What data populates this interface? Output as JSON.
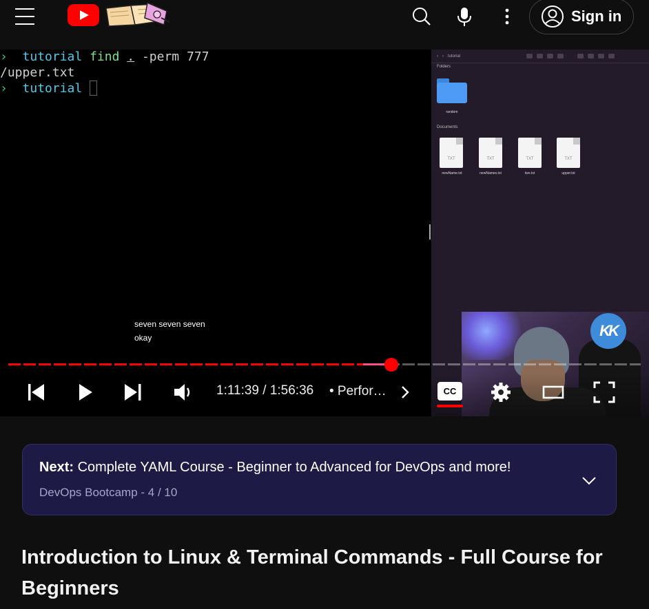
{
  "header": {
    "signin_label": "Sign in",
    "icons": [
      "menu-icon",
      "youtube-logo",
      "search-icon",
      "microphone-icon",
      "more-vertical-icon",
      "account-icon"
    ]
  },
  "player": {
    "terminal": {
      "line1": {
        "arrow": "›",
        "dir": "tutorial",
        "cmd": "find",
        "dot": ".",
        "rest": " -perm 777"
      },
      "line2": "/upper.txt",
      "line3": {
        "arrow": "›",
        "dir": "tutorial"
      }
    },
    "captions": [
      "seven seven seven",
      "okay"
    ],
    "finder": {
      "path": "tutorial",
      "folders_label": "Folders",
      "folder_name": "random",
      "documents_label": "Documents",
      "files": [
        "newName.txt",
        "newNames.txt",
        "two.txt",
        "upper.txt"
      ],
      "file_type": "TXT"
    },
    "channel_badge": "KK",
    "progress": {
      "played_fraction": 0.606,
      "hover_fraction": 0.045
    },
    "time_current": "1:11:39",
    "time_total": "1:56:36",
    "time_display": "1:11:39 / 1:56:36",
    "chapter": "• Perfor…",
    "cc_label": "CC",
    "icons": [
      "previous-icon",
      "play-icon",
      "next-icon",
      "volume-icon",
      "chevron-right-icon",
      "subtitles-icon",
      "settings-icon",
      "theater-mode-icon",
      "fullscreen-icon"
    ]
  },
  "next_card": {
    "prefix": "Next:",
    "title": "Complete YAML Course - Beginner to Advanced for DevOps and more!",
    "playlist": "DevOps Bootcamp - 4 / 10"
  },
  "video_title": "Introduction to Linux & Terminal Commands - Full Course for Beginners",
  "colors": {
    "accent": "#ff0000",
    "next_card_bg": "#1d1a45"
  }
}
